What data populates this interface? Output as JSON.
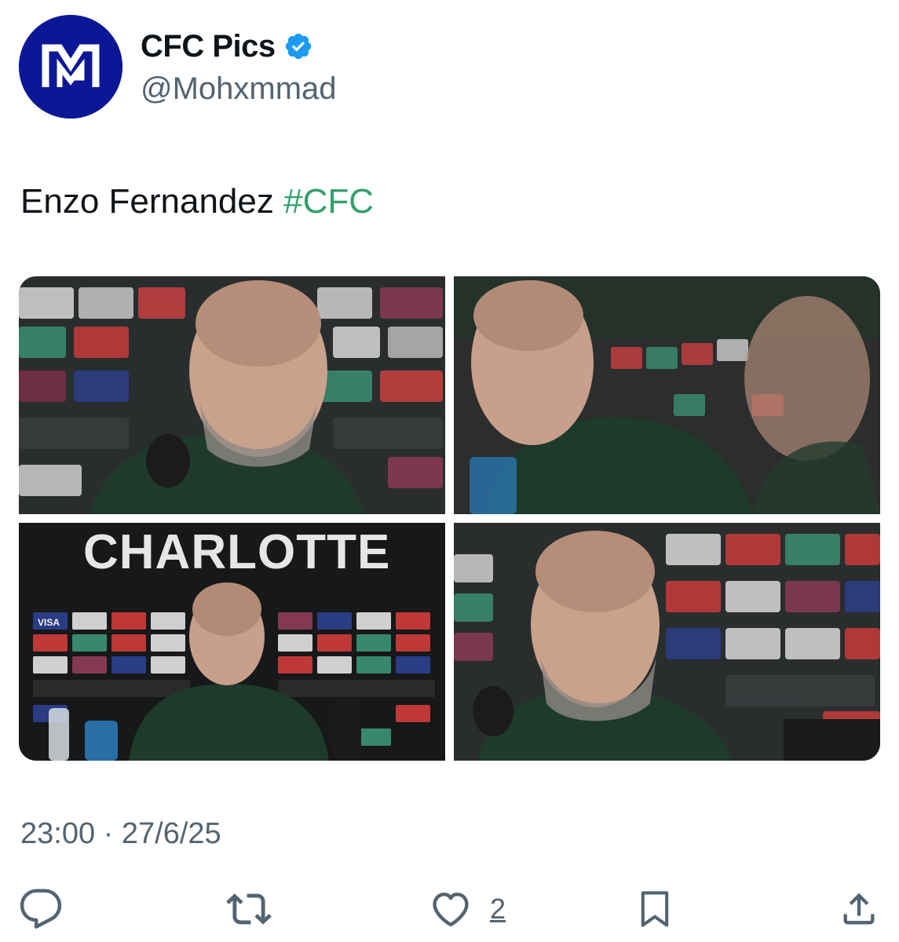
{
  "author": {
    "display_name": "CFC Pics",
    "handle": "@Mohxmmad",
    "verified": true,
    "avatar_icon": "mg-monogram-logo",
    "avatar_color": "#0c1796"
  },
  "tweet": {
    "text": "Enzo Fernandez ",
    "hashtag": "#CFC",
    "hashtag_color": "#33a06b"
  },
  "media": [
    {
      "name": "photo-1",
      "description_icon": "press-conference-photo"
    },
    {
      "name": "photo-2",
      "description_icon": "press-conference-photo"
    },
    {
      "name": "photo-3",
      "banner_text": "CHARLOTTE",
      "board_text": "VISA"
    },
    {
      "name": "photo-4",
      "description_icon": "press-conference-photo"
    }
  ],
  "timestamp": "23:00 · 27/6/25",
  "actions": {
    "reply_icon": "reply-icon",
    "retweet_icon": "retweet-icon",
    "like_icon": "heart-icon",
    "like_count": "2",
    "bookmark_icon": "bookmark-icon",
    "share_icon": "share-icon"
  },
  "colors": {
    "text": "#0f1419",
    "secondary": "#536471",
    "verified_badge": "#1d9bf0"
  }
}
